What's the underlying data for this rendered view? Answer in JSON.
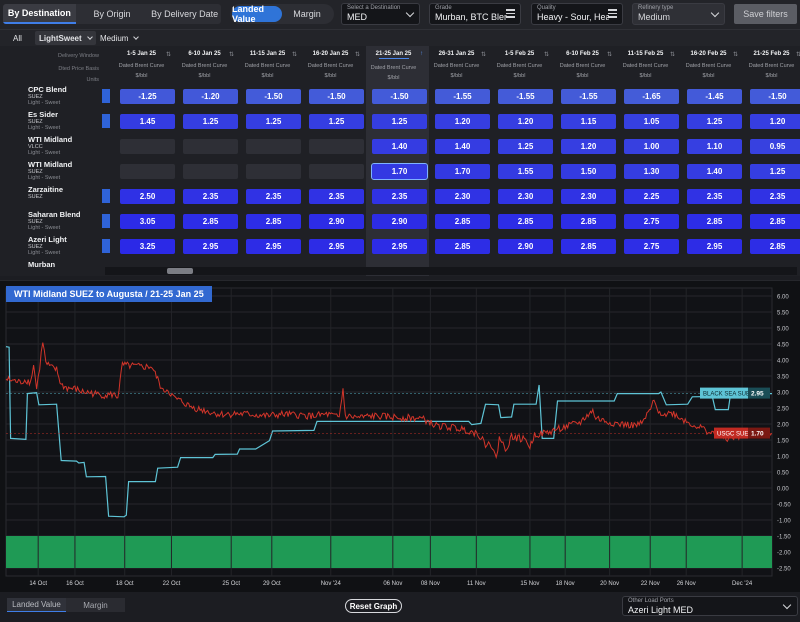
{
  "view_tabs": [
    {
      "label": "By Destination",
      "active": true
    },
    {
      "label": "By Origin",
      "active": false
    },
    {
      "label": "By Delivery Date",
      "active": false
    }
  ],
  "metric_tabs": [
    {
      "label": "Landed Value",
      "active": true
    },
    {
      "label": "Margin",
      "active": false
    }
  ],
  "destination": {
    "label": "Select a Destination",
    "value": "MED"
  },
  "grade": {
    "label": "Grade",
    "value": "Murban, BTC Blen…"
  },
  "quality": {
    "label": "Quality",
    "value": "Heavy - Sour, Hea…"
  },
  "refinery": {
    "label": "Refinery type",
    "value": "Medium"
  },
  "save_filters": "Save filters",
  "filters": {
    "all": "All",
    "light_sweet": "LightSweet",
    "medium": "Medium"
  },
  "grid": {
    "header_labels": {
      "window": "Delivery Window",
      "basis": "Dted Price Basis",
      "units": "Units"
    },
    "columns": [
      {
        "date": "1-5 Jan 25",
        "curve": "Dated Brent Curve",
        "unit": "$/bbl"
      },
      {
        "date": "6-10 Jan 25",
        "curve": "Dated Brent Curve",
        "unit": "$/bbl"
      },
      {
        "date": "11-15 Jan 25",
        "curve": "Dated Brent Curve",
        "unit": "$/bbl"
      },
      {
        "date": "16-20 Jan 25",
        "curve": "Dated Brent Curve",
        "unit": "$/bbl"
      },
      {
        "date": "21-25 Jan 25",
        "curve": "Dated Brent Curve",
        "unit": "$/bbl",
        "selected": true
      },
      {
        "date": "26-31 Jan 25",
        "curve": "Dated Brent Curve",
        "unit": "$/bbl"
      },
      {
        "date": "1-5 Feb 25",
        "curve": "Dated Brent Curve",
        "unit": "$/bbl"
      },
      {
        "date": "6-10 Feb 25",
        "curve": "Dated Brent Curve",
        "unit": "$/bbl"
      },
      {
        "date": "11-15 Feb 25",
        "curve": "Dated Brent Curve",
        "unit": "$/bbl"
      },
      {
        "date": "16-20 Feb 25",
        "curve": "Dated Brent Curve",
        "unit": "$/bbl"
      },
      {
        "date": "21-25 Feb 25",
        "curve": "Dated Brent Curve",
        "unit": "$/bbl"
      }
    ],
    "rows": [
      {
        "name": "CPC Blend",
        "port": "SUEZ",
        "quality": "Light - Sweet",
        "values": [
          "-1.25",
          "-1.20",
          "-1.50",
          "-1.50",
          "-1.50",
          "-1.55",
          "-1.55",
          "-1.55",
          "-1.65",
          "-1.45",
          "-1.50"
        ]
      },
      {
        "name": "Es Sider",
        "port": "SUEZ",
        "quality": "Light - Sweet",
        "values": [
          "1.45",
          "1.25",
          "1.25",
          "1.25",
          "1.25",
          "1.20",
          "1.20",
          "1.15",
          "1.05",
          "1.25",
          "1.20"
        ]
      },
      {
        "name": "WTI Midland",
        "port": "VLCC",
        "quality": "Light - Sweet",
        "values": [
          "",
          "",
          "",
          "",
          "1.40",
          "1.40",
          "1.25",
          "1.20",
          "1.00",
          "1.10",
          "0.95"
        ]
      },
      {
        "name": "WTI Midland",
        "port": "SUEZ",
        "quality": "Light - Sweet",
        "values": [
          "",
          "",
          "",
          "",
          "1.70",
          "1.70",
          "1.55",
          "1.50",
          "1.30",
          "1.40",
          "1.25"
        ],
        "selected_index": 4
      },
      {
        "name": "Zarzaitine",
        "port": "SUEZ",
        "quality": "",
        "values": [
          "2.50",
          "2.35",
          "2.35",
          "2.35",
          "2.35",
          "2.30",
          "2.30",
          "2.30",
          "2.25",
          "2.35",
          "2.35"
        ]
      },
      {
        "name": "Saharan Blend",
        "port": "SUEZ",
        "quality": "Light - Sweet",
        "values": [
          "3.05",
          "2.85",
          "2.85",
          "2.90",
          "2.90",
          "2.85",
          "2.85",
          "2.85",
          "2.75",
          "2.85",
          "2.85"
        ]
      },
      {
        "name": "Azeri Light",
        "port": "SUEZ",
        "quality": "Light - Sweet",
        "values": [
          "3.25",
          "2.95",
          "2.95",
          "2.95",
          "2.95",
          "2.85",
          "2.90",
          "2.85",
          "2.75",
          "2.95",
          "2.85"
        ]
      },
      {
        "name": "Murban",
        "port": "",
        "quality": "",
        "values": [
          "",
          "",
          "",
          "",
          "",
          "",
          "",
          "",
          "",
          "",
          ""
        ]
      }
    ]
  },
  "chart_data": {
    "type": "line",
    "title": "WTI Midland SUEZ to Augusta / 21-25 Jan 25",
    "x_ticks": [
      "14 Oct",
      "16 Oct",
      "18 Oct",
      "22 Oct",
      "25 Oct",
      "29 Oct",
      "Nov '24",
      "06 Nov",
      "08 Nov",
      "11 Nov",
      "15 Nov",
      "18 Nov",
      "20 Nov",
      "22 Nov",
      "26 Nov",
      "Dec '24"
    ],
    "y_ticks": [
      "6.00",
      "5.50",
      "5.00",
      "4.50",
      "4.00",
      "3.50",
      "3.00",
      "2.50",
      "2.00",
      "1.50",
      "1.00",
      "0.50",
      "0.00",
      "-0.50",
      "-1.00",
      "-1.50",
      "-2.00",
      "-2.50"
    ],
    "ylim": [
      -2.75,
      6.25
    ],
    "band": {
      "from": -2.5,
      "to": -1.5,
      "color": "#1f9a55"
    },
    "series": [
      {
        "name": "BLACK SEA SUEZ",
        "color": "#5ec4d6",
        "last_value": "2.95",
        "points": [
          [
            0.0,
            4.42
          ],
          [
            0.4,
            4.4
          ],
          [
            0.6,
            1.55
          ],
          [
            2.6,
            1.52
          ],
          [
            2.8,
            2.95
          ],
          [
            4.0,
            2.98
          ],
          [
            4.3,
            2.6
          ],
          [
            6.6,
            2.62
          ],
          [
            7.2,
            0.86
          ],
          [
            9.2,
            0.84
          ],
          [
            9.5,
            0.78
          ],
          [
            10.2,
            0.8
          ],
          [
            10.5,
            0.35
          ],
          [
            13.0,
            0.36
          ],
          [
            13.4,
            -0.88
          ],
          [
            15.4,
            -0.9
          ],
          [
            15.7,
            -0.85
          ],
          [
            16.0,
            0.2
          ],
          [
            19.5,
            0.2
          ],
          [
            19.8,
            0.62
          ],
          [
            22.4,
            0.65
          ],
          [
            22.8,
            0.95
          ],
          [
            27.0,
            0.95
          ],
          [
            27.3,
            1.05
          ],
          [
            30.2,
            1.06
          ],
          [
            30.5,
            1.22
          ],
          [
            32.6,
            1.22
          ],
          [
            34.4,
            1.48
          ],
          [
            34.8,
            1.78
          ],
          [
            40.2,
            1.8
          ],
          [
            40.6,
            2.08
          ],
          [
            60.4,
            2.08
          ],
          [
            60.8,
            1.98
          ],
          [
            62.0,
            2.02
          ],
          [
            62.6,
            2.62
          ],
          [
            64.3,
            2.6
          ],
          [
            64.6,
            2.2
          ],
          [
            66.0,
            2.22
          ],
          [
            66.3,
            2.62
          ],
          [
            69.2,
            2.62
          ],
          [
            69.6,
            3.22
          ],
          [
            70.0,
            1.55
          ],
          [
            71.5,
            1.55
          ],
          [
            72.0,
            2.72
          ],
          [
            79.4,
            2.72
          ],
          [
            79.8,
            2.95
          ],
          [
            85.2,
            2.95
          ],
          [
            85.5,
            3.0
          ],
          [
            86.2,
            2.6
          ],
          [
            89.0,
            2.62
          ],
          [
            89.6,
            2.85
          ],
          [
            92.2,
            2.86
          ],
          [
            92.6,
            2.45
          ],
          [
            94.3,
            2.45
          ],
          [
            94.6,
            2.95
          ],
          [
            100,
            2.95
          ]
        ]
      },
      {
        "name": "USGC SUEZ",
        "color": "#d3352a",
        "last_value": "1.70",
        "points": [
          [
            0,
            3.4
          ],
          [
            1,
            3.35
          ],
          [
            1.8,
            3.3
          ],
          [
            2.6,
            3.38
          ],
          [
            3.2,
            3.3
          ],
          [
            3.6,
            3.85
          ],
          [
            4.0,
            3.1
          ],
          [
            4.4,
            3.78
          ],
          [
            4.8,
            4.6
          ],
          [
            5.2,
            3.9
          ],
          [
            6.0,
            3.75
          ],
          [
            6.6,
            3.7
          ],
          [
            7.2,
            3.22
          ],
          [
            8,
            3.12
          ],
          [
            9,
            3.1
          ],
          [
            10,
            3.0
          ],
          [
            11,
            2.98
          ],
          [
            12,
            2.92
          ],
          [
            13,
            2.9
          ],
          [
            14,
            2.92
          ],
          [
            14.6,
            2.85
          ],
          [
            15.2,
            3.85
          ],
          [
            16,
            3.82
          ],
          [
            17,
            3.8
          ],
          [
            18,
            3.78
          ],
          [
            19,
            3.8
          ],
          [
            19.8,
            3.4
          ],
          [
            20.5,
            3.0
          ],
          [
            21,
            3.1
          ],
          [
            22,
            2.8
          ],
          [
            23,
            2.7
          ],
          [
            24,
            2.55
          ],
          [
            25,
            2.48
          ],
          [
            26,
            2.42
          ],
          [
            27,
            2.35
          ],
          [
            28,
            2.3
          ],
          [
            30,
            2.32
          ],
          [
            32,
            2.3
          ],
          [
            34,
            2.25
          ],
          [
            36,
            2.3
          ],
          [
            38,
            2.28
          ],
          [
            40,
            2.25
          ],
          [
            42,
            2.3
          ],
          [
            43.5,
            2.2
          ],
          [
            44,
            3.1
          ],
          [
            44.3,
            2.25
          ],
          [
            46,
            2.2
          ],
          [
            48,
            2.25
          ],
          [
            50,
            2.22
          ],
          [
            52,
            2.2
          ],
          [
            54,
            2.18
          ],
          [
            55,
            2.1
          ],
          [
            56,
            1.95
          ],
          [
            58,
            1.9
          ],
          [
            60,
            1.82
          ],
          [
            61.6,
            1.7
          ],
          [
            62.2,
            1.55
          ],
          [
            62.6,
            1.2
          ],
          [
            63,
            1.55
          ],
          [
            64,
            0.9
          ],
          [
            64.4,
            1.6
          ],
          [
            65.2,
            1.2
          ],
          [
            66,
            1.6
          ],
          [
            67,
            1.55
          ],
          [
            68,
            1.5
          ],
          [
            68.4,
            1.25
          ],
          [
            69,
            1.68
          ],
          [
            70,
            1.7
          ],
          [
            71,
            1.75
          ],
          [
            72,
            1.85
          ],
          [
            73,
            1.9
          ],
          [
            74,
            1.98
          ],
          [
            75,
            2.05
          ],
          [
            76,
            2.3
          ],
          [
            76.6,
            2.4
          ],
          [
            77,
            2.2
          ],
          [
            78,
            2.1
          ],
          [
            80,
            2.0
          ],
          [
            82,
            1.95
          ],
          [
            83,
            2.0
          ],
          [
            84,
            2.4
          ],
          [
            84.6,
            2.7
          ],
          [
            85,
            2.45
          ],
          [
            86,
            2.3
          ],
          [
            87,
            2.35
          ],
          [
            88,
            2.2
          ],
          [
            89,
            2.05
          ],
          [
            90,
            1.95
          ],
          [
            91,
            1.85
          ],
          [
            92,
            1.72
          ],
          [
            93,
            1.65
          ],
          [
            94,
            1.55
          ],
          [
            95,
            1.58
          ],
          [
            96,
            1.62
          ],
          [
            97,
            1.66
          ],
          [
            98,
            1.7
          ],
          [
            100,
            1.7
          ]
        ]
      }
    ]
  },
  "footer": {
    "tabs": [
      {
        "label": "Landed Value",
        "active": true
      },
      {
        "label": "Margin",
        "active": false
      }
    ],
    "reset_label": "Reset Graph",
    "other_ports_label": "Other Load Ports",
    "other_ports_value": "Azeri Light MED"
  },
  "colors": {
    "accent": "#2f74d8",
    "cell_base": "#3d55d8",
    "cell_dark": "#2e2be0",
    "selected_outline": "#7fb2ff"
  }
}
